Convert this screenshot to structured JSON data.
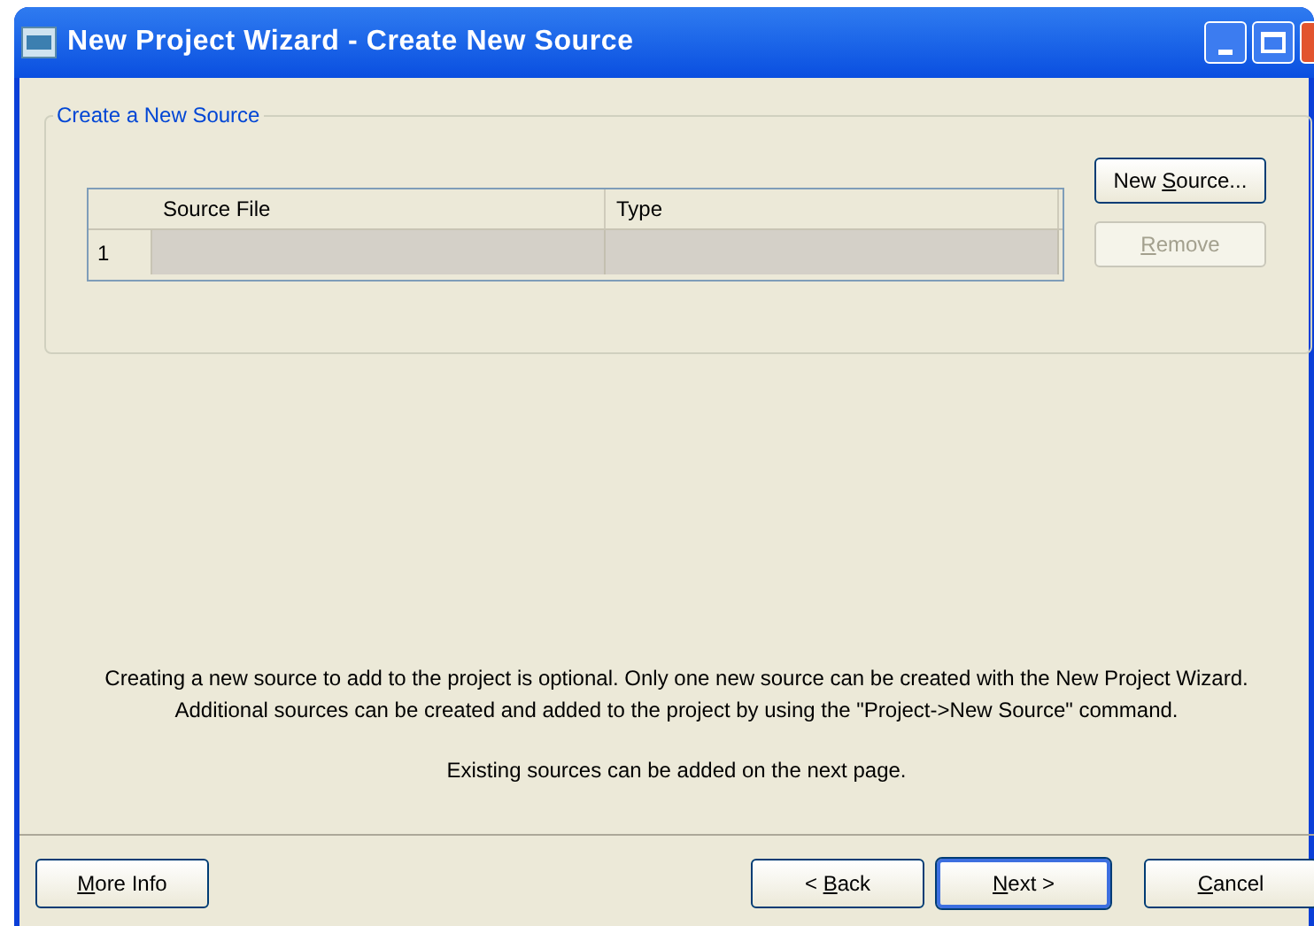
{
  "window": {
    "title": "New Project Wizard - Create New Source"
  },
  "group": {
    "title": "Create a New Source"
  },
  "table": {
    "columns": [
      "Source File",
      "Type"
    ],
    "rows": [
      {
        "number": "1",
        "cells": [
          "",
          ""
        ]
      }
    ]
  },
  "side_buttons": [
    {
      "label": {
        "before": "New ",
        "access_key": "S",
        "after": "ource..."
      },
      "disabled": false
    },
    {
      "label": {
        "access_key": "R",
        "after": "emove"
      },
      "disabled": true
    }
  ],
  "info": [
    "Creating a new source to add to the project is optional. Only one new source can be created with the New Project Wizard.",
    "Additional sources can be created and added to the project by using the \"Project->New Source\" command.",
    "Existing sources can be added on the next page."
  ],
  "footer_buttons": [
    {
      "label": {
        "access_key": "M",
        "after": "ore Info"
      },
      "default": false
    },
    {
      "label": {
        "before": "< ",
        "access_key": "B",
        "after": "ack"
      },
      "default": false
    },
    {
      "label": {
        "access_key": "N",
        "after": "ext >"
      },
      "default": true
    },
    {
      "label": {
        "access_key": "C",
        "after": "ancel"
      },
      "default": false
    }
  ]
}
